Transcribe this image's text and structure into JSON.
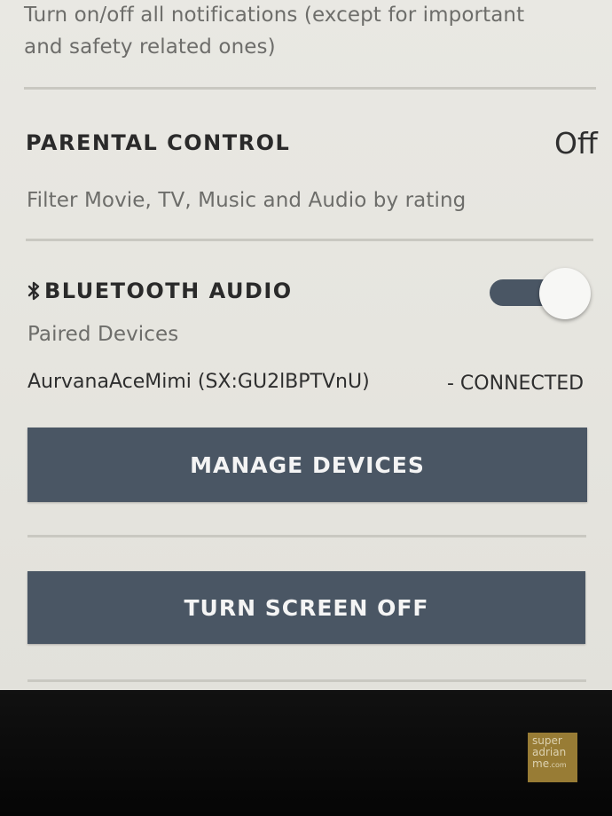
{
  "notifications": {
    "description_line1": "Turn on/off all notifications (except for important",
    "description_line2": "and safety related ones)"
  },
  "parental_control": {
    "title": "PARENTAL CONTROL",
    "value": "Off",
    "description": "Filter Movie, TV, Music and Audio by rating"
  },
  "bluetooth": {
    "icon": "bluetooth-icon",
    "title": "BLUETOOTH AUDIO",
    "toggle_state": "on",
    "paired_label": "Paired Devices",
    "device_name": "AurvanaAceMimi (SX:GU2lBPTVnU)",
    "device_status": "- CONNECTED",
    "manage_button": "MANAGE DEVICES"
  },
  "screen": {
    "turn_off_button": "TURN SCREEN OFF"
  },
  "watermark": {
    "line1": "super",
    "line2": "adrian",
    "line3": "me",
    "line3_suffix": ".com"
  },
  "colors": {
    "screen_bg": "#e7e6e0",
    "button_bg": "#4a5664",
    "button_text": "#f4f4f4",
    "toggle_track": "#4a5664",
    "bezel": "#0a0a0a"
  }
}
